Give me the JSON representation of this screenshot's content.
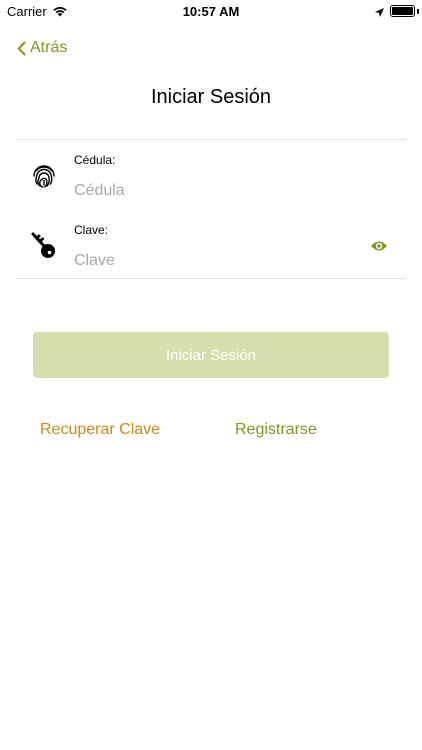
{
  "status_bar": {
    "carrier": "Carrier",
    "time": "10:57 AM",
    "icons": [
      "wifi-icon",
      "location-arrow-icon",
      "battery-icon"
    ]
  },
  "nav": {
    "back_label": "Atrás"
  },
  "page": {
    "title": "Iniciar Sesión"
  },
  "form": {
    "cedula": {
      "label": "Cédula:",
      "placeholder": "Cédula",
      "value": "",
      "icon": "fingerprint-icon"
    },
    "clave": {
      "label": "Clave:",
      "placeholder": "Clave",
      "value": "",
      "icon": "key-icon",
      "toggle_icon": "eye-icon"
    }
  },
  "actions": {
    "login_label": "Iniciar Sesión",
    "recover_label": "Recuperar Clave",
    "register_label": "Registrarse"
  },
  "colors": {
    "accent_green": "#7a9a22",
    "button_disabled": "#d5deac",
    "recover_orange": "#c98a1a",
    "divider": "#e3e3e3",
    "placeholder": "#a9a9ad"
  }
}
